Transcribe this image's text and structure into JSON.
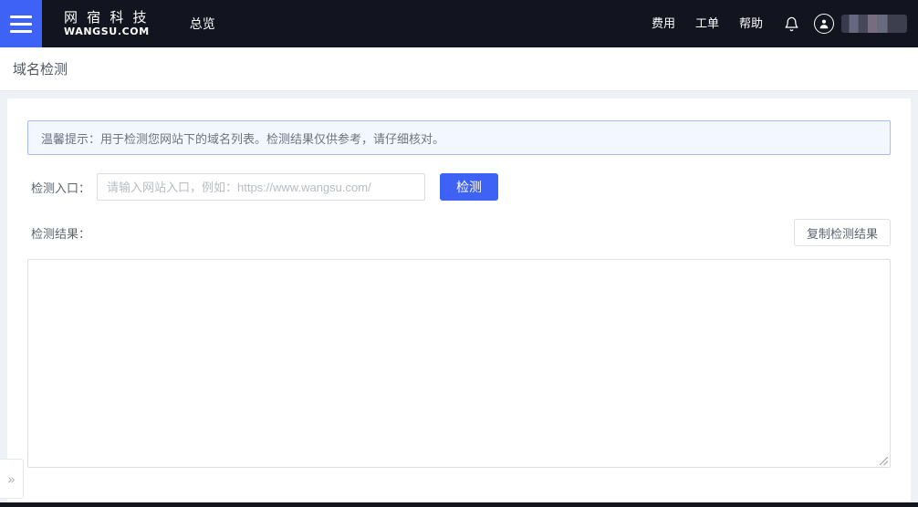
{
  "header": {
    "menu_icon": "hamburger-menu-icon",
    "logo_cn": "网 宿 科 技",
    "logo_en": "WANGSU.COM",
    "nav_items": [
      {
        "label": "总览"
      }
    ],
    "right_links": [
      {
        "label": "费用"
      },
      {
        "label": "工单"
      },
      {
        "label": "帮助"
      }
    ],
    "bell_icon": "notification-bell-icon",
    "avatar_icon": "user-avatar-icon",
    "username": "",
    "username_state": "redacted",
    "accent_color": "#3d62f5",
    "background_color": "#12151f"
  },
  "titlebar": {
    "title": "域名检测"
  },
  "content": {
    "tip": {
      "text": "温馨提示：用于检测您网站下的域名列表。检测结果仅供参考，请仔细核对。",
      "border_color": "#a9bcf2",
      "background_color": "#f3f7ff"
    },
    "entry_field": {
      "label": "检测入口：",
      "value": "",
      "placeholder": "请输入网站入口，例如：https://www.wangsu.com/"
    },
    "detect_button": {
      "label": "检测",
      "color": "#3d62f5"
    },
    "result": {
      "label": "检测结果：",
      "copy_button_label": "复制检测结果",
      "value": "",
      "placeholder": ""
    }
  },
  "expander": {
    "glyph": "»",
    "icon": "chevron-double-right-icon"
  }
}
